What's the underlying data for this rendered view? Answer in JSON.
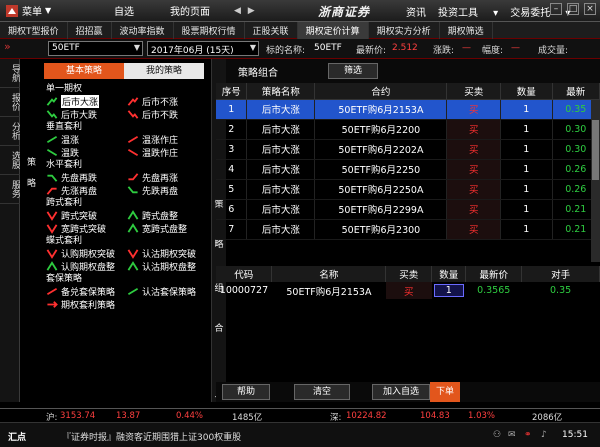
{
  "topbar": {
    "menu_label": "菜单",
    "nav": [
      "自选",
      "我的页面"
    ],
    "arrows": "◀ ▶",
    "brand": "浙商证券",
    "right_nav": [
      "资讯",
      "投资工具",
      "交易委托"
    ]
  },
  "tabs": [
    "期权T型报价",
    "招招赢",
    "波动率指数",
    "股票期权行情",
    "正股关联",
    "期权定价计算",
    "期权实方分析",
    "期权筛选"
  ],
  "selector": {
    "underlying": "50ETF",
    "expiry": "2017年06月 (15天)",
    "name_label": "标的名称:",
    "name_value": "50ETF",
    "last_label": "最新价:",
    "last_value": "2.512",
    "change_label": "涨跌:",
    "change_value": "—",
    "range_label": "幅度:",
    "range_value": "—",
    "volume_label": "成交量:"
  },
  "left_nav": [
    "导航",
    "报价",
    "分析",
    "选股",
    "服务"
  ],
  "strategy_panel": {
    "side_label": "策略",
    "tabs": [
      "基本策略",
      "我的策略"
    ],
    "categories": [
      {
        "name": "单一期权",
        "items": [
          "后市大涨",
          "后市不涨",
          "后市大跌",
          "后市不跌"
        ],
        "icons": [
          "up",
          "up-red",
          "down",
          "down-red"
        ]
      },
      {
        "name": "垂直套利",
        "items": [
          "温涨",
          "温涨作庄",
          "温跌",
          "温跌作庄"
        ],
        "icons": [
          "up-small",
          "up-small-red",
          "down-small",
          "down-small-red"
        ]
      },
      {
        "name": "水平套利",
        "items": [
          "先盘再跌",
          "先盘再涨",
          "先涨再盘",
          "先跌再盘"
        ],
        "icons": [
          "flat-down",
          "flat-up",
          "up-flat",
          "down-flat"
        ]
      },
      {
        "name": "跨式套利",
        "items": [
          "跨式突破",
          "跨式盘整",
          "宽跨式突破",
          "宽跨式盘整"
        ],
        "icons": [
          "v",
          "caret",
          "v",
          "caret"
        ]
      },
      {
        "name": "蝶式套利",
        "items": [
          "认购期权突破",
          "认沽期权突破",
          "认购期权盘整",
          "认沽期权盘整"
        ],
        "icons": [
          "v",
          "v",
          "caret",
          "caret"
        ]
      },
      {
        "name": "套保策略",
        "items": [
          "备兑套保策略",
          "认沽套保策略",
          "期权套利策略"
        ],
        "icons": [
          "up-small-red",
          "up-small",
          "arrow-right"
        ]
      }
    ]
  },
  "combo_panel": {
    "side_label": "策略组合",
    "title": "策略组合",
    "filter_button": "筛选",
    "headers": [
      "序号",
      "策略名称",
      "合约",
      "买卖",
      "数量",
      "最新"
    ],
    "rows": [
      {
        "no": "1",
        "strategy": "后市大涨",
        "contract": "50ETF购6月2153A",
        "side": "买",
        "qty": "1",
        "last": "0.35"
      },
      {
        "no": "2",
        "strategy": "后市大涨",
        "contract": "50ETF购6月2200",
        "side": "买",
        "qty": "1",
        "last": "0.30"
      },
      {
        "no": "3",
        "strategy": "后市大涨",
        "contract": "50ETF购6月2202A",
        "side": "买",
        "qty": "1",
        "last": "0.30"
      },
      {
        "no": "4",
        "strategy": "后市大涨",
        "contract": "50ETF购6月2250",
        "side": "买",
        "qty": "1",
        "last": "0.26"
      },
      {
        "no": "5",
        "strategy": "后市大涨",
        "contract": "50ETF购6月2250A",
        "side": "买",
        "qty": "1",
        "last": "0.26"
      },
      {
        "no": "6",
        "strategy": "后市大涨",
        "contract": "50ETF购6月2299A",
        "side": "买",
        "qty": "1",
        "last": "0.21"
      },
      {
        "no": "7",
        "strategy": "后市大涨",
        "contract": "50ETF购6月2300",
        "side": "买",
        "qty": "1",
        "last": "0.21"
      }
    ]
  },
  "order_panel": {
    "headers": [
      "代码",
      "名称",
      "买卖",
      "数量",
      "最新价",
      "对手"
    ],
    "rows": [
      {
        "code": "10000727",
        "name": "50ETF购6月2153A",
        "side": "买",
        "qty": "1",
        "last": "0.3565",
        "counter": "0.35"
      }
    ],
    "buttons": [
      "帮助",
      "清空",
      "加入自选",
      "下单"
    ]
  },
  "statusbar": {
    "sh_label": "沪:",
    "sh_index": "3153.74",
    "sh_change": "13.87",
    "sh_pct": "0.44%",
    "sh_amount": "1485亿",
    "sz_label": "深:",
    "sz_index": "10224.82",
    "sz_change": "104.83",
    "sz_pct": "1.03%",
    "sz_amount": "2086亿"
  },
  "footer": {
    "label": "汇点",
    "ticker": "『证券时报』融资客近期围猎上证300权重股",
    "time": "15:51"
  },
  "colors": {
    "accent": "#e2561c",
    "up": "#ff3030",
    "down": "#2ecc40",
    "highlight": "#2255cc"
  }
}
